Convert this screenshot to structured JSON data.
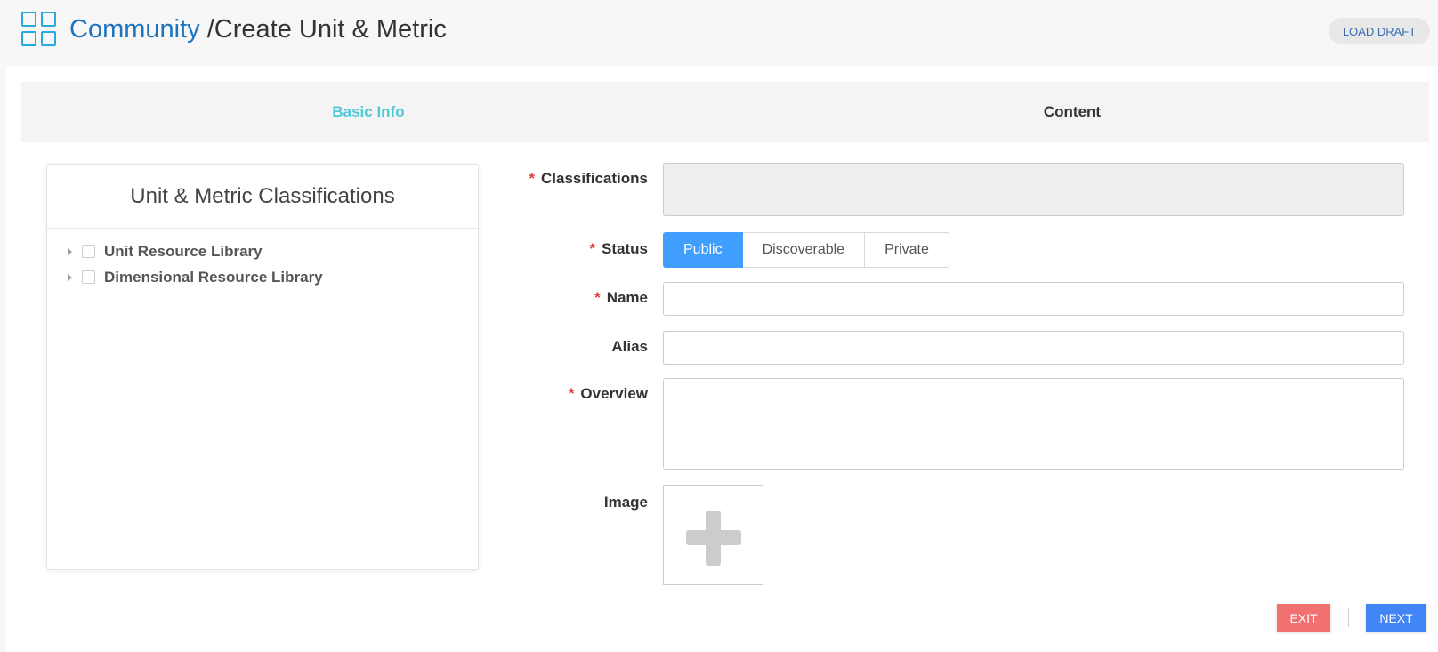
{
  "header": {
    "breadcrumb_root": "Community",
    "breadcrumb_page": "/Create Unit & Metric",
    "load_draft_label": "LOAD DRAFT"
  },
  "steps": [
    {
      "label": "Basic Info",
      "active": true
    },
    {
      "label": "Content",
      "active": false
    }
  ],
  "classifications_panel": {
    "title": "Unit & Metric Classifications",
    "items": [
      {
        "label": "Unit Resource Library"
      },
      {
        "label": "Dimensional Resource Library"
      }
    ]
  },
  "form": {
    "required_marker": "*",
    "classifications_label": "Classifications",
    "status_label": "Status",
    "status_options": [
      "Public",
      "Discoverable",
      "Private"
    ],
    "status_selected": "Public",
    "name_label": "Name",
    "name_value": "",
    "alias_label": "Alias",
    "alias_value": "",
    "overview_label": "Overview",
    "image_label": "Image"
  },
  "footer": {
    "exit_label": "EXIT",
    "next_label": "NEXT"
  },
  "colors": {
    "accent": "#409eff",
    "active_step": "#4fc9d6",
    "breadcrumb_root": "#1e73be",
    "exit": "#f17171",
    "next": "#4285f4",
    "required": "#e53935"
  }
}
